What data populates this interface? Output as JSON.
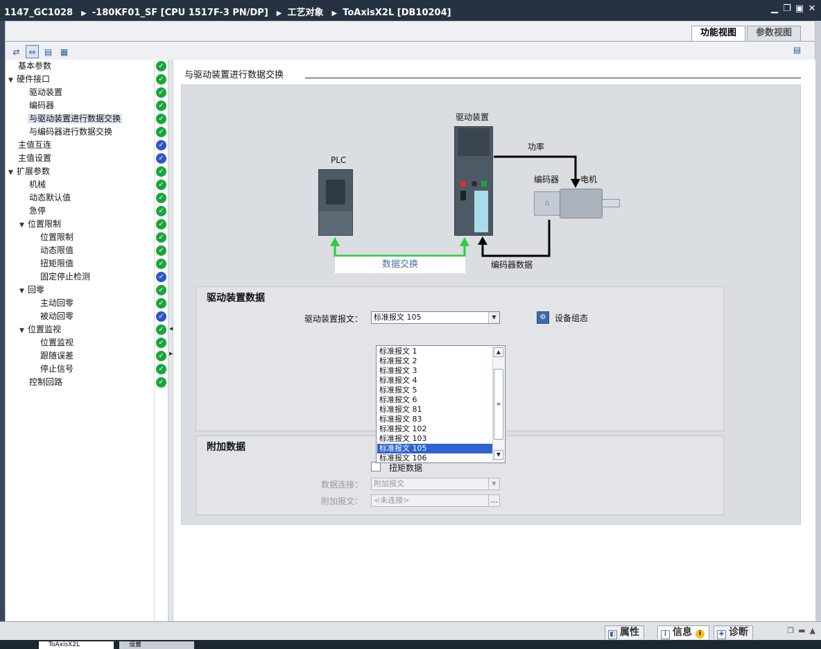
{
  "titlebar": {
    "path": [
      "1147_GC1028",
      "-180KF01_SF [CPU 1517F-3 PN/DP]",
      "工艺对象",
      "ToAxisX2L [DB10204]"
    ],
    "separator": "▶"
  },
  "view_tabs": {
    "function_view": "功能视图",
    "parameter_view": "参数视图"
  },
  "tree": [
    {
      "label": "基本参数",
      "status": "green"
    },
    {
      "label": "硬件接口",
      "status": "green",
      "expanded": true
    },
    {
      "label": "驱动装置",
      "status": "green"
    },
    {
      "label": "编码器",
      "status": "green"
    },
    {
      "label": "与驱动装置进行数据交换",
      "status": "green",
      "selected": true
    },
    {
      "label": "与编码器进行数据交换",
      "status": "green"
    },
    {
      "label": "主值互连",
      "status": "blue"
    },
    {
      "label": "主值设置",
      "status": "blue"
    },
    {
      "label": "扩展参数",
      "status": "green",
      "expanded": true
    },
    {
      "label": "机械",
      "status": "green"
    },
    {
      "label": "动态默认值",
      "status": "green"
    },
    {
      "label": "急停",
      "status": "green"
    },
    {
      "label": "位置限制",
      "status": "green",
      "expanded": true
    },
    {
      "label": "位置限制",
      "status": "green"
    },
    {
      "label": "动态限值",
      "status": "green"
    },
    {
      "label": "扭矩限值",
      "status": "green"
    },
    {
      "label": "固定停止检测",
      "status": "blue"
    },
    {
      "label": "回零",
      "status": "green",
      "expanded": true
    },
    {
      "label": "主动回零",
      "status": "green"
    },
    {
      "label": "被动回零",
      "status": "blue"
    },
    {
      "label": "位置监视",
      "status": "green",
      "expanded": true
    },
    {
      "label": "位置监视",
      "status": "green"
    },
    {
      "label": "跟随误差",
      "status": "green"
    },
    {
      "label": "停止信号",
      "status": "green"
    },
    {
      "label": "控制回路",
      "status": "green"
    }
  ],
  "section": {
    "title": "与驱动装置进行数据交换"
  },
  "diagram": {
    "drive_label": "驱动装置",
    "plc_label": "PLC",
    "power_label": "功率",
    "encoder_label": "编码器",
    "motor_label": "电机",
    "exchange_label": "数据交换",
    "encoder_data_label": "编码器数据"
  },
  "drive_data": {
    "title": "驱动装置数据",
    "telegram_label": "驱动装置报文：",
    "telegram_value": "标准报文 105",
    "config_button": "设备组态"
  },
  "dropdown_options": [
    "标准报文 1",
    "标准报文 2",
    "标准报文 3",
    "标准报文 4",
    "标准报文 5",
    "标准报文 6",
    "标准报文 81",
    "标准报文 83",
    "标准报文 102",
    "标准报文 103",
    "标准报文 105",
    "标准报文 106"
  ],
  "dropdown_selected": "标准报文 105",
  "extra_data": {
    "title": "附加数据",
    "torque_checkbox": "扭矩数据",
    "data_connection_label": "数据连接：",
    "data_connection_value": "附加报文",
    "extra_telegram_label": "附加报文：",
    "extra_telegram_value": "<未连接>",
    "browse_button": "..."
  },
  "bottom_tabs": {
    "properties": "属性",
    "info": "信息",
    "diagnostics": "诊断"
  },
  "taskbar": {
    "tab1": "ToAxisX2L",
    "tab2": "设置"
  },
  "colors": {
    "status_green": "#19a53b",
    "status_blue": "#2e55c9",
    "exchange_arrow": "#2ecc40",
    "selection": "#2f63cf"
  }
}
